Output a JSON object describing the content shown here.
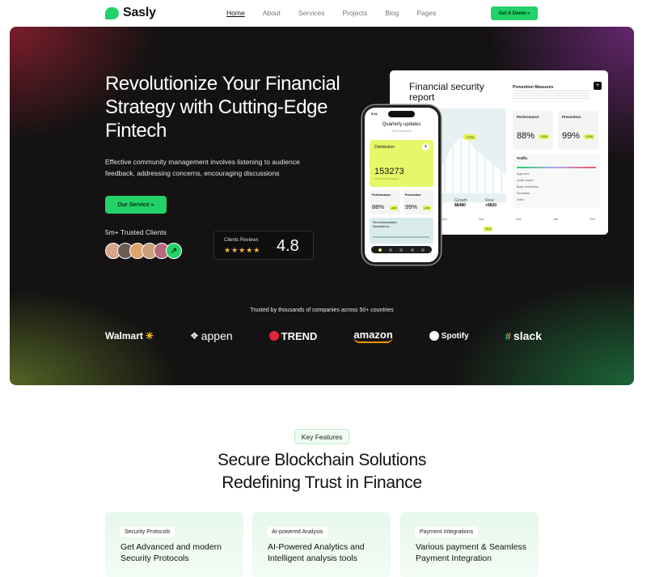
{
  "brand": {
    "name": "Sasly",
    "accent": "#22d167"
  },
  "nav": {
    "links": [
      "Home",
      "About",
      "Services",
      "Projects",
      "Blog",
      "Pages"
    ],
    "active": "Home",
    "cta": "Get A Demo »"
  },
  "hero": {
    "title": "Revolutionize Your Financial Strategy with Cutting-Edge Fintech",
    "subtitle": "Effective community management involves listening to audience feedback, addressing concerns, encouraging discussions",
    "cta": "Our Service »",
    "trusted_clients": "5m+ Trusted Clients",
    "reviews_label": "Clients Reviews",
    "stars": "★★★★★",
    "rating": "4.8",
    "trusted_by": "Trusted by thousands of companies across 50+ countries",
    "brands": [
      "Walmart",
      "appen",
      "TREND",
      "amazon",
      "Spotify",
      "slack"
    ]
  },
  "dashboard": {
    "title": "Financial security report",
    "prevention_title": "Prevention Measures",
    "tag": "+12%",
    "kpi_left_label": "Growth",
    "kpi_left": "$8480",
    "kpi_right_label": "Flow",
    "kpi_right": "+9820",
    "card_performance": {
      "title": "Performance",
      "value": "88%",
      "badge": "+12%"
    },
    "card_prevention": {
      "title": "Prevention",
      "value": "99%",
      "badge": "+12%"
    },
    "traffic_title": "Traffic",
    "traffic_rows": [
      "Approved",
      "Under review",
      "Blank Verification",
      "Flourishes",
      "Other"
    ],
    "axis": [
      "Dec",
      "Nov",
      "Dec",
      "Jan",
      "Feb"
    ],
    "axis_tag": "+4.3"
  },
  "phone": {
    "time": "9:41",
    "heading": "Quarterly updates",
    "heading_sub": "Short Summary",
    "distribution_label": "Distribution",
    "distribution_value": "153273",
    "card_performance": {
      "title": "Performance",
      "value": "88%",
      "badge": "+12%"
    },
    "card_prevention": {
      "title": "Prevention",
      "value": "99%",
      "badge": "+12%"
    },
    "recommendation": "Recommendation transactions"
  },
  "features": {
    "pill": "Key Features",
    "title_line1": "Secure Blockchain Solutions",
    "title_line2": "Redefining Trust in Finance",
    "cards": [
      {
        "tag": "Security Protocols",
        "heading": "Get Advanced and modern Security Protocols"
      },
      {
        "tag": "AI-powered Analysis",
        "heading": "AI-Powered Analytics and Intelligent analysis tools"
      },
      {
        "tag": "Payment Integrations",
        "heading": "Various payment & Seamless Payment Integration"
      }
    ]
  }
}
